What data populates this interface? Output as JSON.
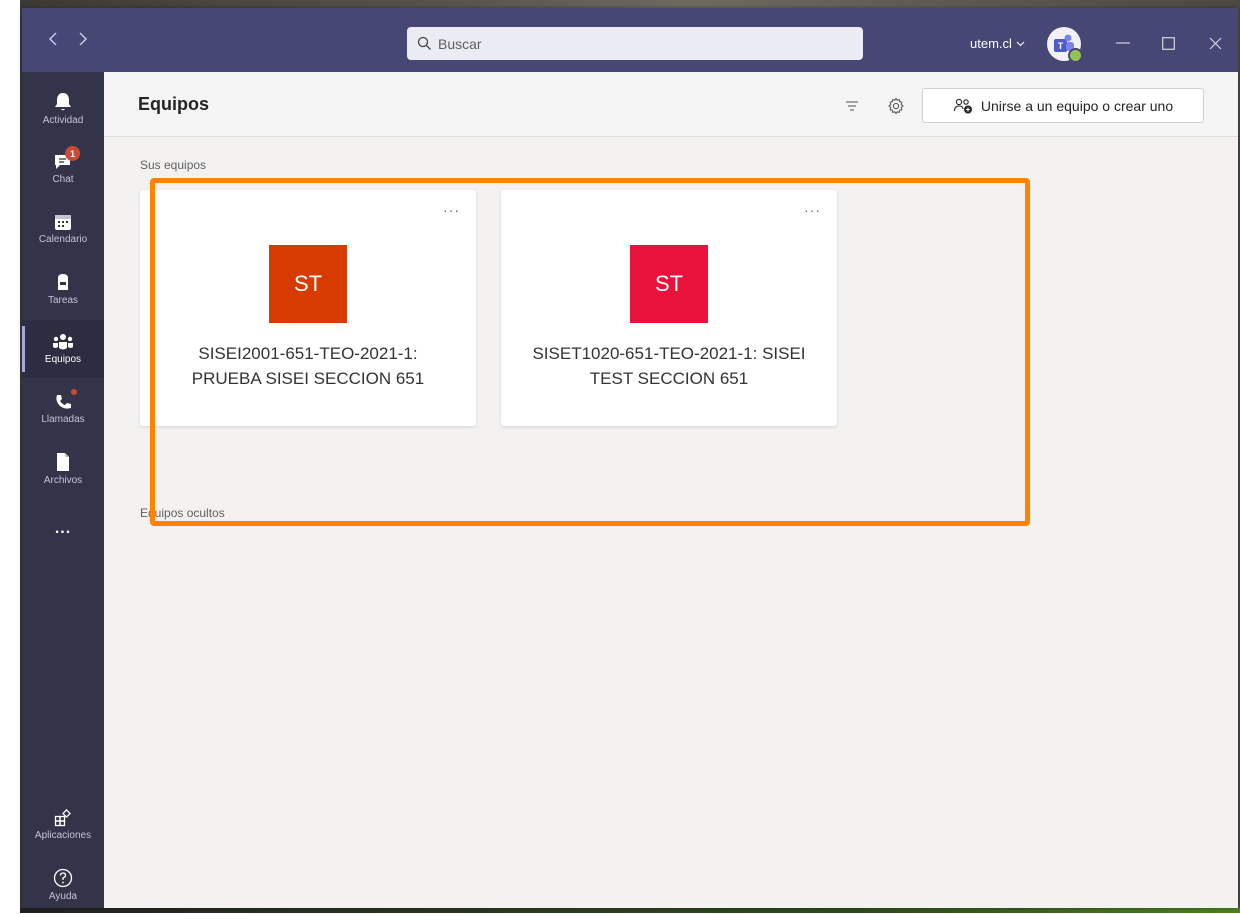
{
  "search": {
    "placeholder": "Buscar"
  },
  "titlebar": {
    "tenant": "utem.cl"
  },
  "rail": {
    "items": [
      {
        "label": "Actividad"
      },
      {
        "label": "Chat",
        "badge": "1"
      },
      {
        "label": "Calendario"
      },
      {
        "label": "Tareas"
      },
      {
        "label": "Equipos"
      },
      {
        "label": "Llamadas"
      },
      {
        "label": "Archivos"
      },
      {
        "label": "..."
      }
    ],
    "bottom": [
      {
        "label": "Aplicaciones"
      },
      {
        "label": "Ayuda"
      }
    ]
  },
  "header": {
    "title": "Equipos",
    "join_button": "Unirse a un equipo o crear uno"
  },
  "sections": {
    "your_teams": "Sus equipos",
    "hidden_teams": "Equipos ocultos"
  },
  "teams": [
    {
      "initials": "ST",
      "name_line1": "SISEI2001-651-TEO-2021-1:",
      "name_line2": "PRUEBA SISEI SECCION 651",
      "color": "#d83b01"
    },
    {
      "initials": "ST",
      "name_line1": "SISET1020-651-TEO-2021-1: SISEI",
      "name_line2": "TEST SECCION 651",
      "color": "#e8123c"
    }
  ],
  "colors": {
    "titlebar": "#464775",
    "rail": "#33344a",
    "highlight": "#ff8300"
  }
}
